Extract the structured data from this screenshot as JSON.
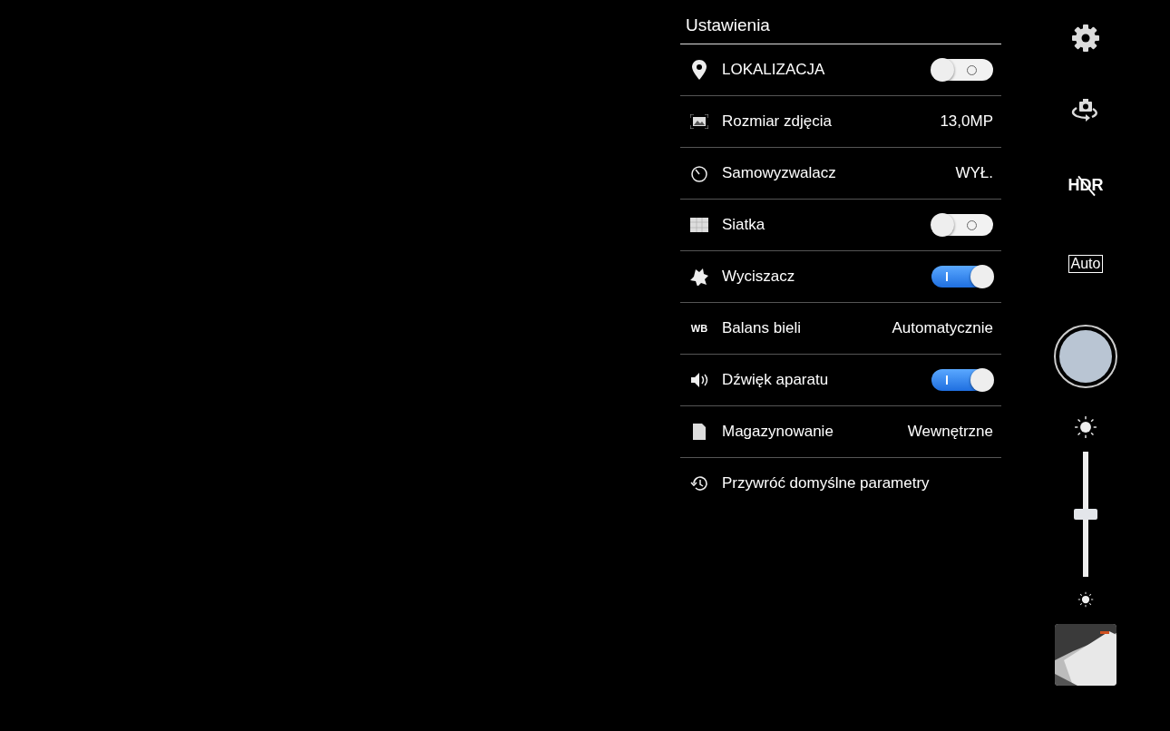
{
  "settings": {
    "title": "Ustawienia",
    "rows": [
      {
        "kind": "toggle",
        "label": "LOKALIZACJA",
        "on": false
      },
      {
        "kind": "value",
        "label": "Rozmiar zdjęcia",
        "value": "13,0MP"
      },
      {
        "kind": "value",
        "label": "Samowyzwalacz",
        "value": "WYŁ."
      },
      {
        "kind": "toggle",
        "label": "Siatka",
        "on": false
      },
      {
        "kind": "toggle",
        "label": "Wyciszacz",
        "on": true
      },
      {
        "kind": "value",
        "label": "Balans bieli",
        "value": "Automatycznie",
        "badge": "WB"
      },
      {
        "kind": "toggle",
        "label": "Dźwięk aparatu",
        "on": true
      },
      {
        "kind": "value",
        "label": "Magazynowanie",
        "value": "Wewnętrzne"
      },
      {
        "kind": "action",
        "label": "Przywróć domyślne parametry"
      }
    ]
  },
  "controls": {
    "hdr": "HDR",
    "mode": "Auto",
    "exposure": {
      "level": 0.5
    }
  }
}
